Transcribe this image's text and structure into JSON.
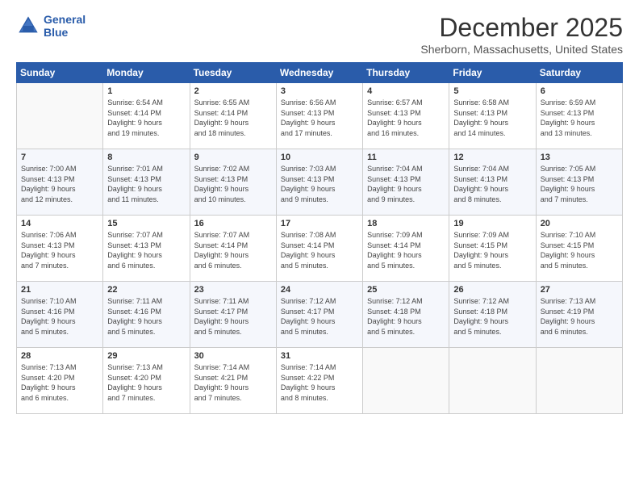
{
  "header": {
    "logo_line1": "General",
    "logo_line2": "Blue",
    "title": "December 2025",
    "location": "Sherborn, Massachusetts, United States"
  },
  "days_of_week": [
    "Sunday",
    "Monday",
    "Tuesday",
    "Wednesday",
    "Thursday",
    "Friday",
    "Saturday"
  ],
  "weeks": [
    [
      {
        "day": "",
        "info": ""
      },
      {
        "day": "1",
        "info": "Sunrise: 6:54 AM\nSunset: 4:14 PM\nDaylight: 9 hours\nand 19 minutes."
      },
      {
        "day": "2",
        "info": "Sunrise: 6:55 AM\nSunset: 4:14 PM\nDaylight: 9 hours\nand 18 minutes."
      },
      {
        "day": "3",
        "info": "Sunrise: 6:56 AM\nSunset: 4:13 PM\nDaylight: 9 hours\nand 17 minutes."
      },
      {
        "day": "4",
        "info": "Sunrise: 6:57 AM\nSunset: 4:13 PM\nDaylight: 9 hours\nand 16 minutes."
      },
      {
        "day": "5",
        "info": "Sunrise: 6:58 AM\nSunset: 4:13 PM\nDaylight: 9 hours\nand 14 minutes."
      },
      {
        "day": "6",
        "info": "Sunrise: 6:59 AM\nSunset: 4:13 PM\nDaylight: 9 hours\nand 13 minutes."
      }
    ],
    [
      {
        "day": "7",
        "info": "Sunrise: 7:00 AM\nSunset: 4:13 PM\nDaylight: 9 hours\nand 12 minutes."
      },
      {
        "day": "8",
        "info": "Sunrise: 7:01 AM\nSunset: 4:13 PM\nDaylight: 9 hours\nand 11 minutes."
      },
      {
        "day": "9",
        "info": "Sunrise: 7:02 AM\nSunset: 4:13 PM\nDaylight: 9 hours\nand 10 minutes."
      },
      {
        "day": "10",
        "info": "Sunrise: 7:03 AM\nSunset: 4:13 PM\nDaylight: 9 hours\nand 9 minutes."
      },
      {
        "day": "11",
        "info": "Sunrise: 7:04 AM\nSunset: 4:13 PM\nDaylight: 9 hours\nand 9 minutes."
      },
      {
        "day": "12",
        "info": "Sunrise: 7:04 AM\nSunset: 4:13 PM\nDaylight: 9 hours\nand 8 minutes."
      },
      {
        "day": "13",
        "info": "Sunrise: 7:05 AM\nSunset: 4:13 PM\nDaylight: 9 hours\nand 7 minutes."
      }
    ],
    [
      {
        "day": "14",
        "info": "Sunrise: 7:06 AM\nSunset: 4:13 PM\nDaylight: 9 hours\nand 7 minutes."
      },
      {
        "day": "15",
        "info": "Sunrise: 7:07 AM\nSunset: 4:13 PM\nDaylight: 9 hours\nand 6 minutes."
      },
      {
        "day": "16",
        "info": "Sunrise: 7:07 AM\nSunset: 4:14 PM\nDaylight: 9 hours\nand 6 minutes."
      },
      {
        "day": "17",
        "info": "Sunrise: 7:08 AM\nSunset: 4:14 PM\nDaylight: 9 hours\nand 5 minutes."
      },
      {
        "day": "18",
        "info": "Sunrise: 7:09 AM\nSunset: 4:14 PM\nDaylight: 9 hours\nand 5 minutes."
      },
      {
        "day": "19",
        "info": "Sunrise: 7:09 AM\nSunset: 4:15 PM\nDaylight: 9 hours\nand 5 minutes."
      },
      {
        "day": "20",
        "info": "Sunrise: 7:10 AM\nSunset: 4:15 PM\nDaylight: 9 hours\nand 5 minutes."
      }
    ],
    [
      {
        "day": "21",
        "info": "Sunrise: 7:10 AM\nSunset: 4:16 PM\nDaylight: 9 hours\nand 5 minutes."
      },
      {
        "day": "22",
        "info": "Sunrise: 7:11 AM\nSunset: 4:16 PM\nDaylight: 9 hours\nand 5 minutes."
      },
      {
        "day": "23",
        "info": "Sunrise: 7:11 AM\nSunset: 4:17 PM\nDaylight: 9 hours\nand 5 minutes."
      },
      {
        "day": "24",
        "info": "Sunrise: 7:12 AM\nSunset: 4:17 PM\nDaylight: 9 hours\nand 5 minutes."
      },
      {
        "day": "25",
        "info": "Sunrise: 7:12 AM\nSunset: 4:18 PM\nDaylight: 9 hours\nand 5 minutes."
      },
      {
        "day": "26",
        "info": "Sunrise: 7:12 AM\nSunset: 4:18 PM\nDaylight: 9 hours\nand 5 minutes."
      },
      {
        "day": "27",
        "info": "Sunrise: 7:13 AM\nSunset: 4:19 PM\nDaylight: 9 hours\nand 6 minutes."
      }
    ],
    [
      {
        "day": "28",
        "info": "Sunrise: 7:13 AM\nSunset: 4:20 PM\nDaylight: 9 hours\nand 6 minutes."
      },
      {
        "day": "29",
        "info": "Sunrise: 7:13 AM\nSunset: 4:20 PM\nDaylight: 9 hours\nand 7 minutes."
      },
      {
        "day": "30",
        "info": "Sunrise: 7:14 AM\nSunset: 4:21 PM\nDaylight: 9 hours\nand 7 minutes."
      },
      {
        "day": "31",
        "info": "Sunrise: 7:14 AM\nSunset: 4:22 PM\nDaylight: 9 hours\nand 8 minutes."
      },
      {
        "day": "",
        "info": ""
      },
      {
        "day": "",
        "info": ""
      },
      {
        "day": "",
        "info": ""
      }
    ]
  ]
}
